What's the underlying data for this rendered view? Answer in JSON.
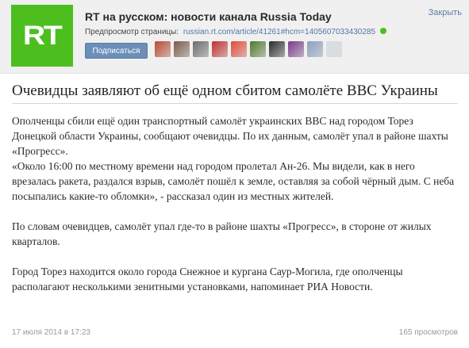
{
  "header": {
    "logo_text": "RT",
    "title": "RT на русском: новости канала Russia Today",
    "close_label": "Закрыть",
    "preview_label": "Предпросмотр страницы:",
    "preview_url": "russian.rt.com/article/41261#hcm=1405607033430285",
    "subscribe_label": "Подписаться",
    "subscriber_avatars": [
      {
        "icon": "avatar-1",
        "color": "#b84a32"
      },
      {
        "icon": "avatar-2",
        "color": "#7a5a48"
      },
      {
        "icon": "avatar-3",
        "color": "#6c6c6c"
      },
      {
        "icon": "avatar-4",
        "color": "#c23030"
      },
      {
        "icon": "avatar-5",
        "color": "#e24a3a"
      },
      {
        "icon": "avatar-6",
        "color": "#4f7a2c"
      },
      {
        "icon": "avatar-7",
        "color": "#2a2a2a"
      },
      {
        "icon": "avatar-8",
        "color": "#7a3a8a"
      },
      {
        "icon": "avatar-9",
        "color": "#8aa0c0"
      },
      {
        "icon": "avatar-10",
        "color": "#d8dde5"
      }
    ]
  },
  "article": {
    "title": "Очевидцы заявляют об ещё одном сбитом самолёте ВВС Украины",
    "paragraphs": [
      "Ополченцы сбили ещё один транспортный самолёт украинских ВВС над городом Торез Донецкой области Украины, сообщают очевидцы. По их данным, самолёт упал в районе шахты «Прогресс».",
      "«Около 16:00 по местному времени над городом пролетал Ан-26. Мы видели, как в него врезалась ракета, раздался взрыв, самолёт пошёл к земле, оставляя за собой чёрный дым. С неба посыпались какие-то обломки», - рассказал один из местных жителей.",
      "По словам очевидцев, самолёт упал где-то в районе шахты «Прогресс», в стороне от жилых кварталов.",
      "Город Торез находится около города Снежное и кургана Саур-Могила, где ополченцы располагают несколькими зенитными установками, напоминает РИА Новости."
    ]
  },
  "footer": {
    "date": "17 июля 2014 в 17:23",
    "views": "165 просмотров"
  }
}
